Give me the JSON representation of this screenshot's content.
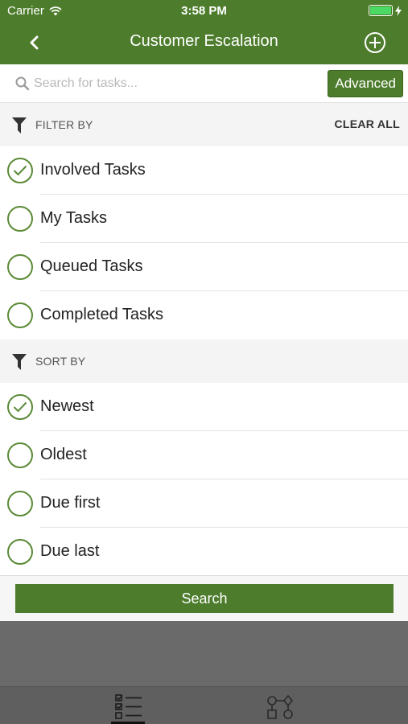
{
  "status_bar": {
    "carrier": "Carrier",
    "time": "3:58 PM"
  },
  "nav": {
    "title": "Customer Escalation"
  },
  "search": {
    "placeholder": "Search for tasks...",
    "value": "",
    "advanced_label": "Advanced"
  },
  "filter": {
    "header": "FILTER BY",
    "clear_all": "CLEAR ALL",
    "options": [
      {
        "label": "Involved Tasks",
        "checked": true
      },
      {
        "label": "My Tasks",
        "checked": false
      },
      {
        "label": "Queued Tasks",
        "checked": false
      },
      {
        "label": "Completed Tasks",
        "checked": false
      }
    ]
  },
  "sort": {
    "header": "SORT BY",
    "options": [
      {
        "label": "Newest",
        "checked": true
      },
      {
        "label": "Oldest",
        "checked": false
      },
      {
        "label": "Due first",
        "checked": false
      },
      {
        "label": "Due last",
        "checked": false
      }
    ]
  },
  "search_button": {
    "label": "Search"
  },
  "colors": {
    "brand_green": "#4d7d2c",
    "battery_green": "#4cd964",
    "overlay_gray": "#6a6a6a"
  },
  "icons": {
    "back": "chevron-left-icon",
    "add": "add-circle-icon",
    "search": "search-icon",
    "filter": "funnel-icon",
    "check": "checkmark-icon",
    "tasks_tab": "task-list-icon",
    "process_tab": "process-shapes-icon"
  }
}
